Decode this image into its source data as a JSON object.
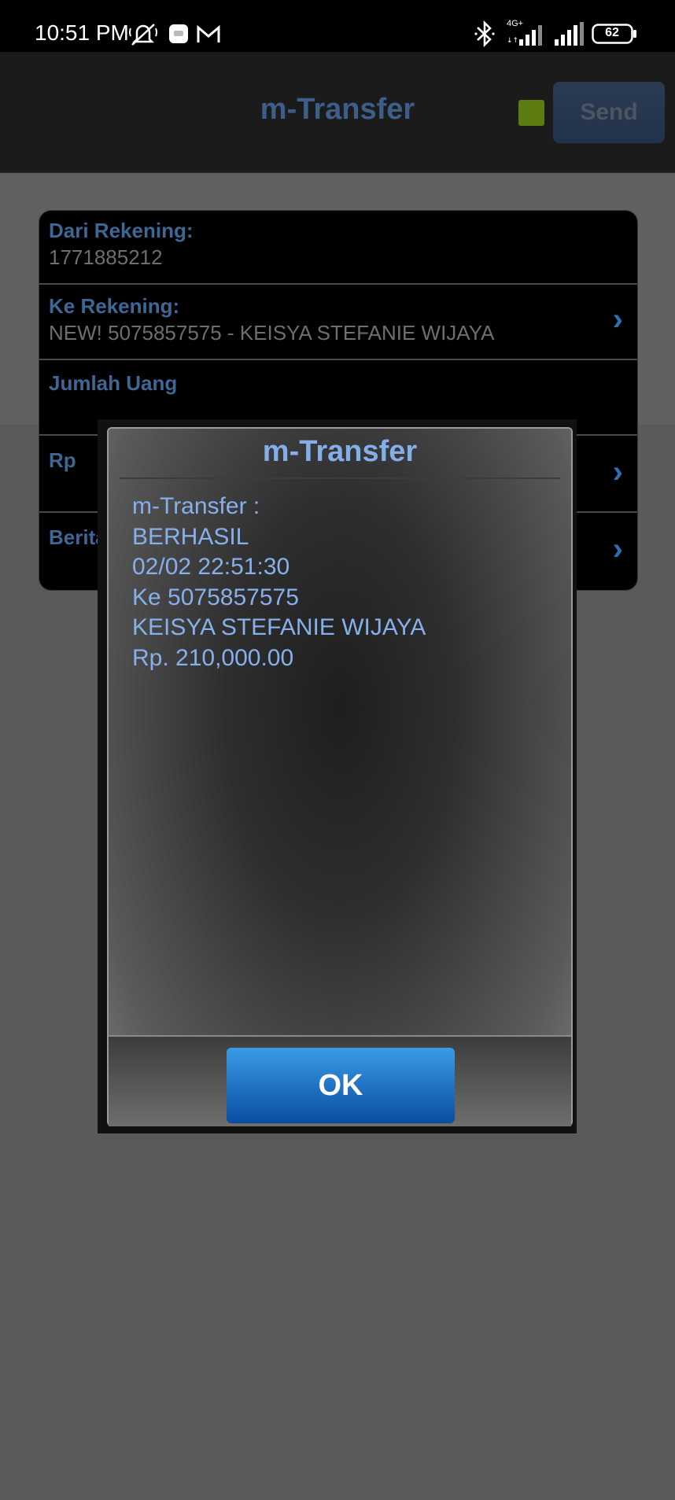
{
  "status_bar": {
    "time": "10:51 PM",
    "icons": [
      "mute-icon",
      "message-icon",
      "gmail-icon",
      "bluetooth-icon",
      "signal-4g-icon",
      "signal-icon",
      "battery-icon"
    ],
    "network_label": "4G+",
    "battery_level": "62"
  },
  "app_bar": {
    "title": "m-Transfer",
    "send_label": "Send",
    "indicator_color": "#5d7d13"
  },
  "form": {
    "from_label": "Dari Rekening:",
    "from_value": "1771885212",
    "to_label": "Ke Rekening:",
    "to_value": "NEW! 5075857575 - KEISYA STEFANIE WIJAYA",
    "amount_label": "Jumlah Uang",
    "currency_label": "Rp",
    "note_label": "Berita"
  },
  "dialog": {
    "title": "m-Transfer",
    "lines": [
      "m-Transfer :",
      "BERHASIL",
      "02/02 22:51:30",
      "Ke 5075857575",
      "KEISYA STEFANIE WIJAYA",
      "Rp. 210,000.00"
    ],
    "ok_label": "OK"
  },
  "colors": {
    "accent_blue": "#86b0ec",
    "button_blue": "#0a4da0"
  }
}
